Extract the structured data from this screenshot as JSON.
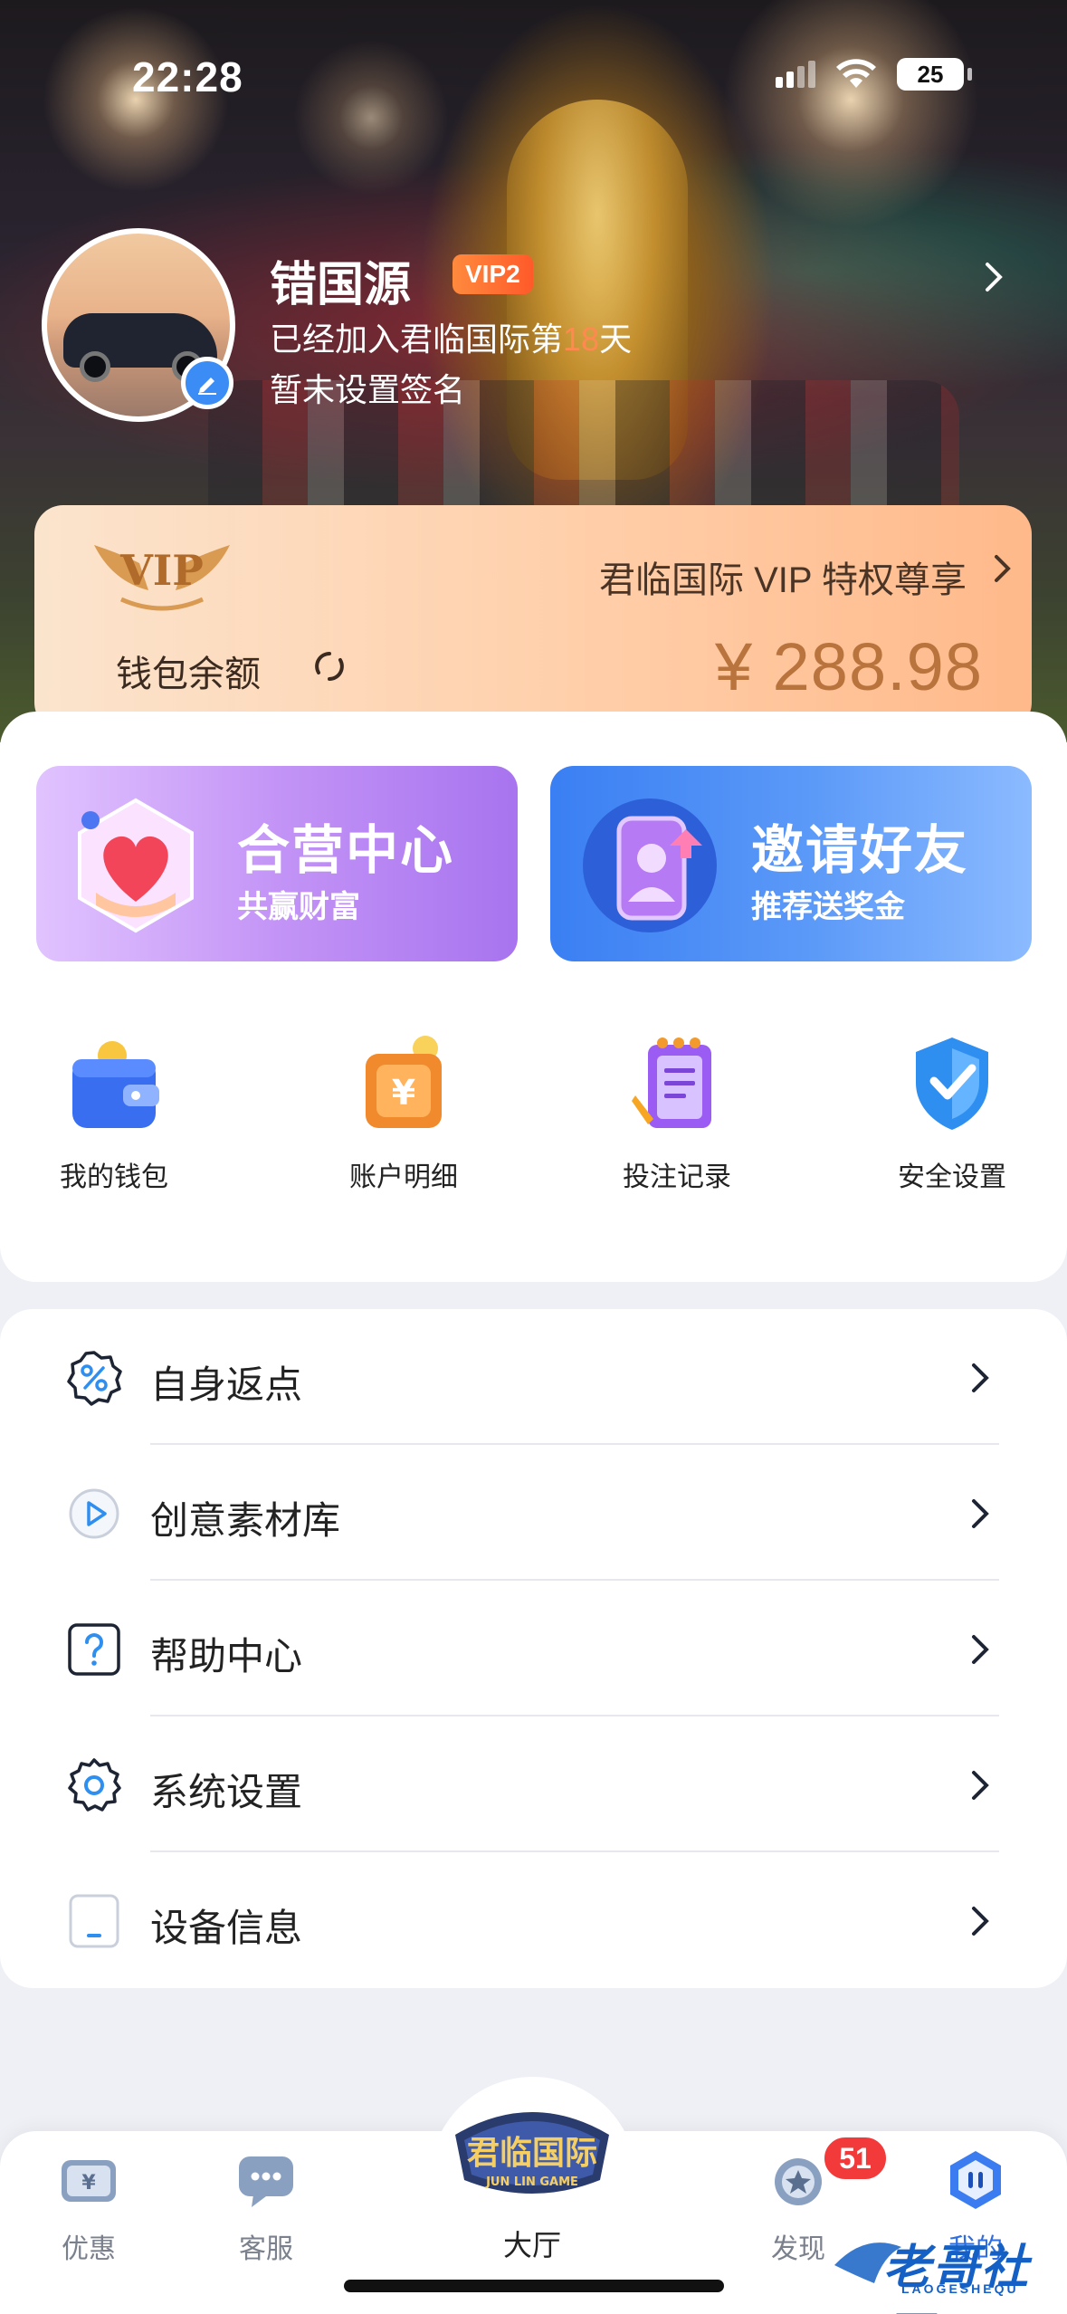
{
  "status_bar": {
    "time": "22:28",
    "battery": "25"
  },
  "profile": {
    "name": "错国源",
    "vip_level": "VIP2",
    "joined_prefix": "已经加入君临国际第",
    "joined_days": "18",
    "joined_suffix": "天",
    "signature": "暂未设置签名"
  },
  "vip_card": {
    "logo_text": "VIP",
    "title": "君临国际 VIP 特权尊享",
    "wallet_label": "钱包余额",
    "balance": "¥ 288.98"
  },
  "promos": [
    {
      "title": "合营中心",
      "subtitle": "共赢财富"
    },
    {
      "title": "邀请好友",
      "subtitle": "推荐送奖金"
    }
  ],
  "quick_actions": [
    {
      "label": "我的钱包",
      "icon": "wallet-icon"
    },
    {
      "label": "账户明细",
      "icon": "account-details-icon"
    },
    {
      "label": "投注记录",
      "icon": "bet-record-icon"
    },
    {
      "label": "安全设置",
      "icon": "security-shield-icon"
    }
  ],
  "menu": [
    {
      "label": "自身返点",
      "icon": "rebate-percent-icon"
    },
    {
      "label": "创意素材库",
      "icon": "play-circle-icon"
    },
    {
      "label": "帮助中心",
      "icon": "help-question-icon"
    },
    {
      "label": "系统设置",
      "icon": "gear-icon"
    },
    {
      "label": "设备信息",
      "icon": "device-icon"
    }
  ],
  "tabbar": {
    "tabs": [
      {
        "label": "优惠",
        "icon": "coupon-icon"
      },
      {
        "label": "客服",
        "icon": "chat-icon"
      },
      {
        "label": "大厅",
        "icon": "hall-logo",
        "logo_text": "君临国际",
        "logo_sub": "JUN LIN GAME"
      },
      {
        "label": "发现",
        "icon": "discover-star-icon",
        "badge": "51"
      },
      {
        "label": "我的",
        "icon": "profile-hex-icon"
      }
    ]
  },
  "watermark": {
    "text": "老哥社区",
    "sub": "LAOGESHEQU"
  },
  "colors": {
    "vip_orange": "#ff6a30",
    "balance_gold": "#b9733c",
    "partner_purple": "#b07ff2",
    "invite_blue": "#4a8cf6",
    "badge_red": "#f23a3a"
  }
}
